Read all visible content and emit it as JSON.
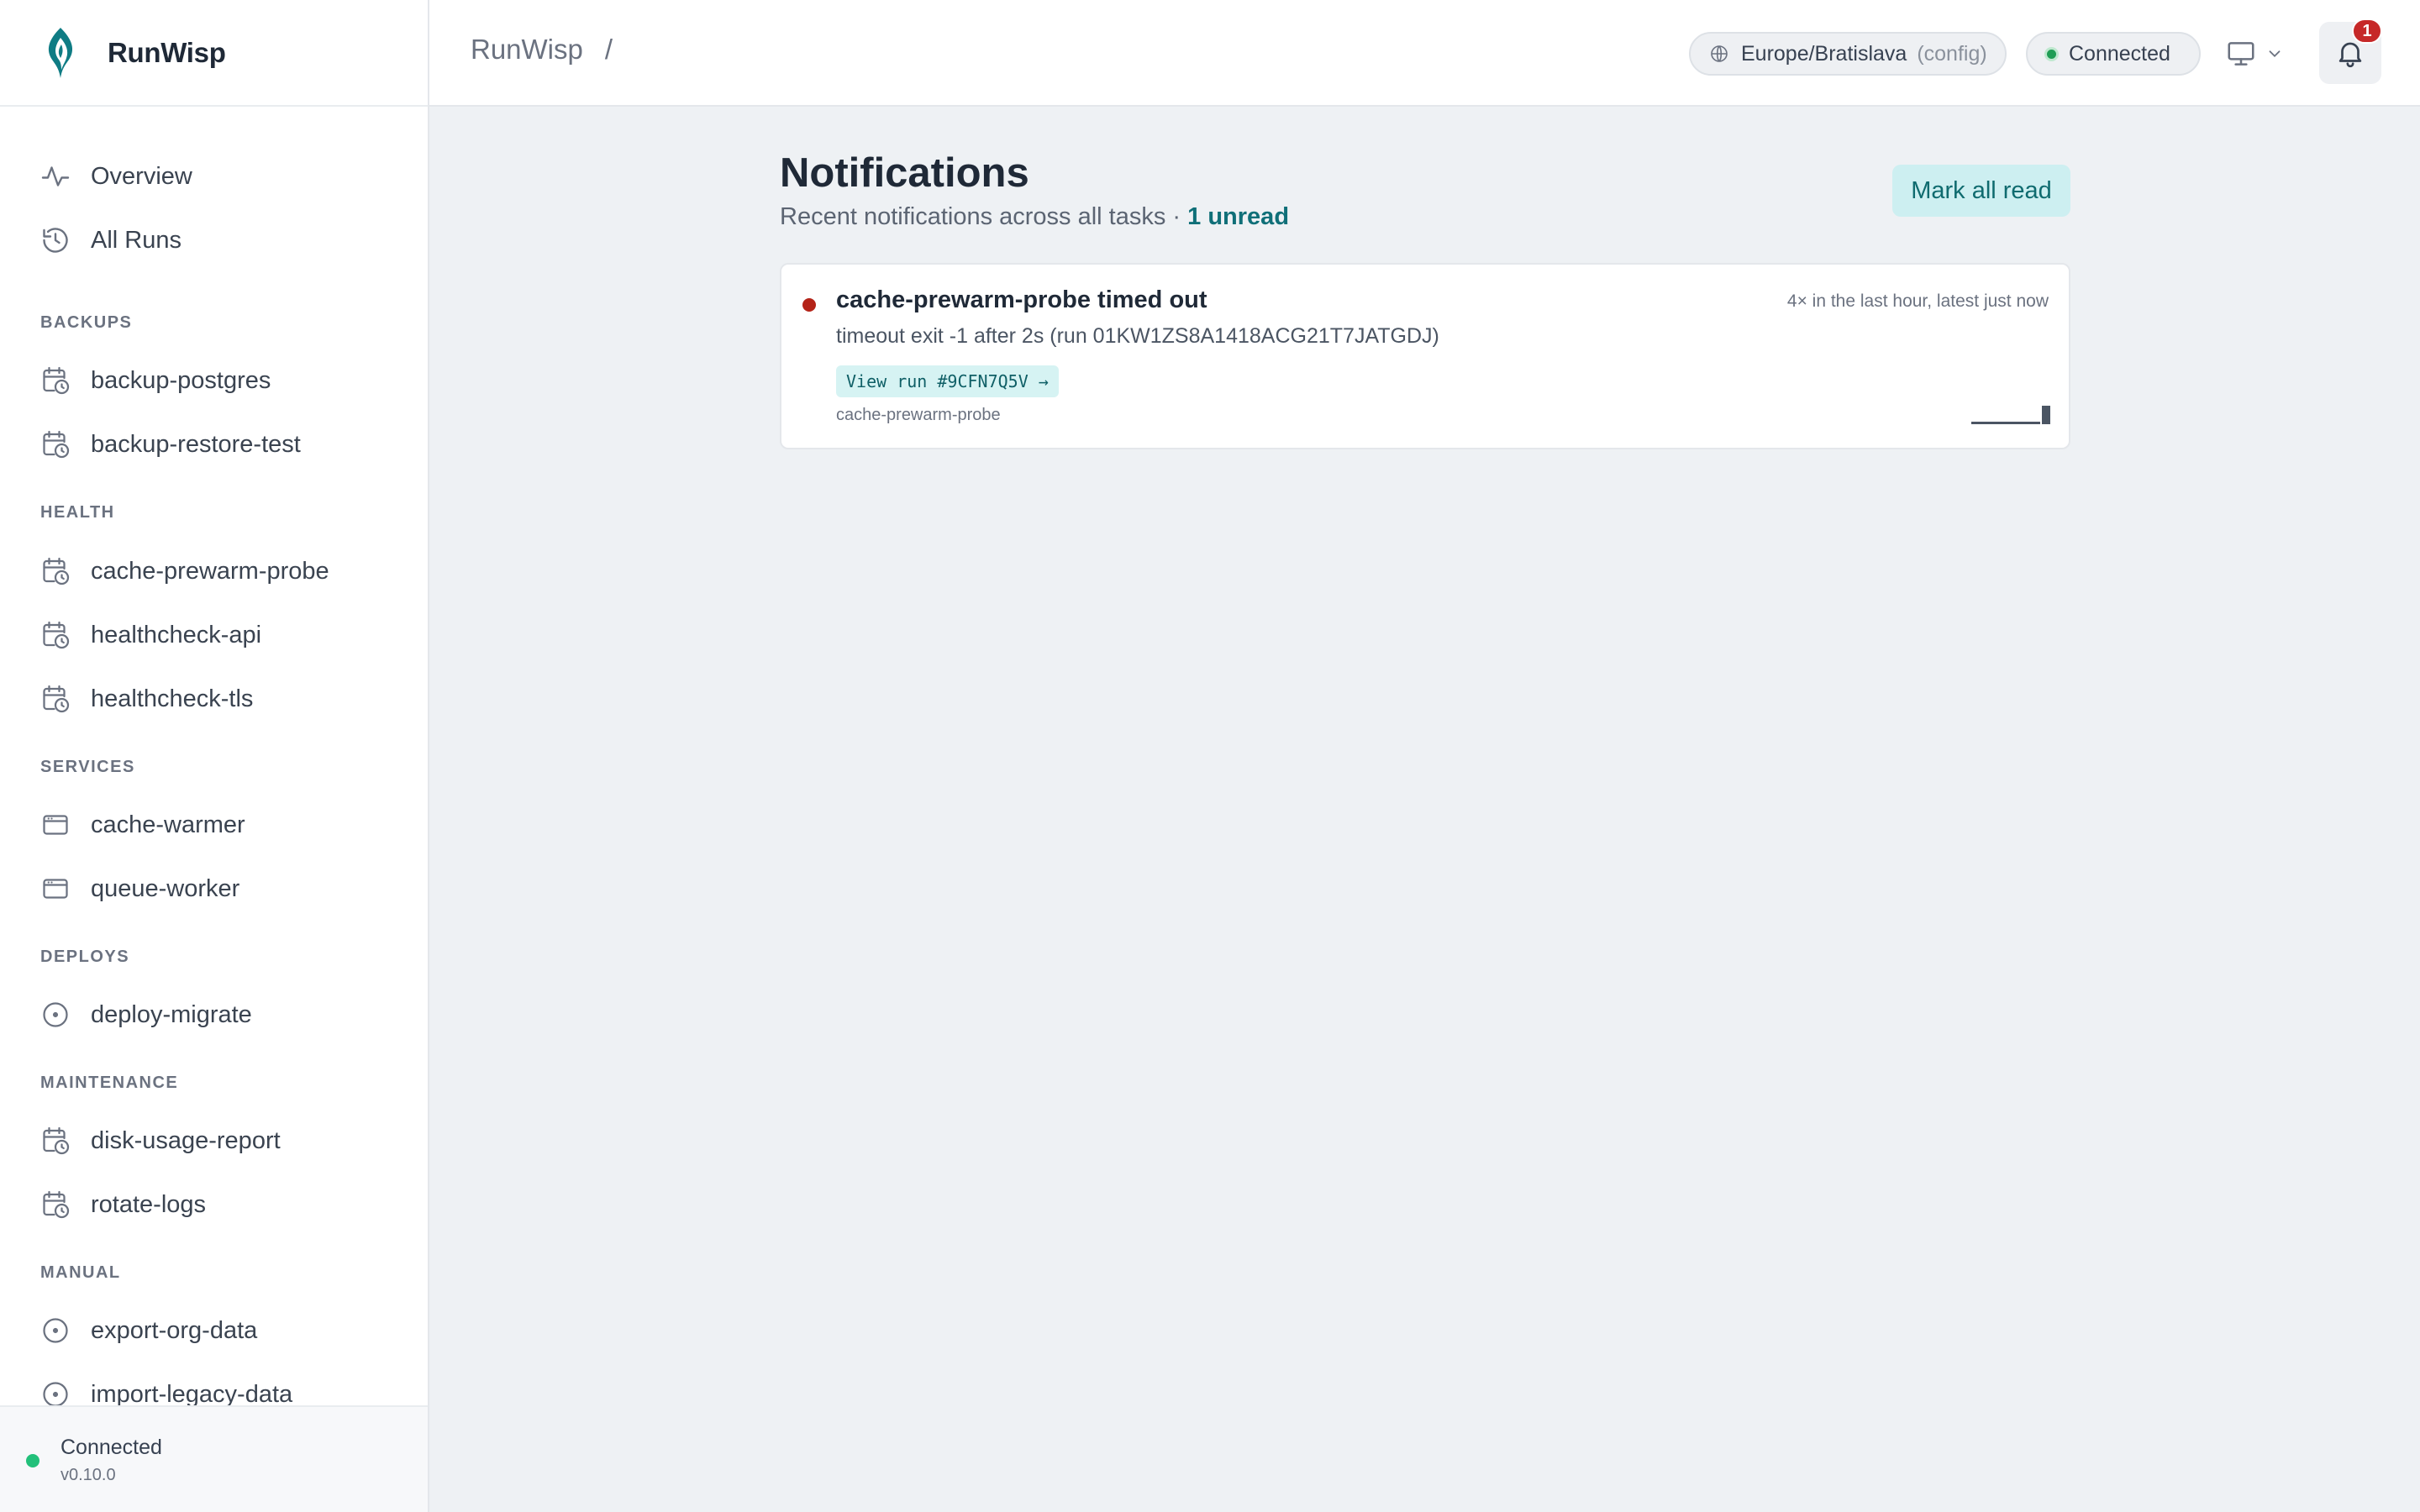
{
  "app": {
    "name": "RunWisp",
    "version": "v0.10.0",
    "status": "Connected"
  },
  "colors": {
    "accent": "#0f6f78",
    "connected": "#22c07a",
    "error": "#b42318",
    "badge": "#c62828"
  },
  "header": {
    "breadcrumb": "RunWisp",
    "breadcrumb_separator": "/",
    "timezone": "Europe/Bratislava",
    "timezone_source": "(config)",
    "connection": "Connected",
    "notification_count": "1",
    "icons": [
      "globe-icon",
      "monitor-icon",
      "chevron-down-icon",
      "bell-icon"
    ]
  },
  "sidebar": {
    "top": [
      {
        "label": "Overview",
        "icon": "activity-icon"
      },
      {
        "label": "All Runs",
        "icon": "history-icon"
      }
    ],
    "sections": [
      {
        "title": "BACKUPS",
        "items": [
          {
            "label": "backup-postgres",
            "icon": "calendar-clock-icon"
          },
          {
            "label": "backup-restore-test",
            "icon": "calendar-clock-icon"
          }
        ]
      },
      {
        "title": "HEALTH",
        "items": [
          {
            "label": "cache-prewarm-probe",
            "icon": "calendar-clock-icon"
          },
          {
            "label": "healthcheck-api",
            "icon": "calendar-clock-icon"
          },
          {
            "label": "healthcheck-tls",
            "icon": "calendar-clock-icon"
          }
        ]
      },
      {
        "title": "SERVICES",
        "items": [
          {
            "label": "cache-warmer",
            "icon": "window-icon"
          },
          {
            "label": "queue-worker",
            "icon": "window-icon"
          }
        ]
      },
      {
        "title": "DEPLOYS",
        "items": [
          {
            "label": "deploy-migrate",
            "icon": "circle-dot-icon"
          }
        ]
      },
      {
        "title": "MAINTENANCE",
        "items": [
          {
            "label": "disk-usage-report",
            "icon": "calendar-clock-icon"
          },
          {
            "label": "rotate-logs",
            "icon": "calendar-clock-icon"
          }
        ]
      },
      {
        "title": "MANUAL",
        "items": [
          {
            "label": "export-org-data",
            "icon": "circle-dot-icon"
          },
          {
            "label": "import-legacy-data",
            "icon": "circle-dot-icon"
          }
        ]
      }
    ]
  },
  "main": {
    "title": "Notifications",
    "subtitle": "Recent notifications across all tasks ·",
    "unread": "1 unread",
    "mark_all_read": "Mark all read",
    "notifications": [
      {
        "title": "cache-prewarm-probe timed out",
        "meta": "4× in the last hour, latest just now",
        "body": "timeout exit -1 after 2s (run 01KW1ZS8A1418ACG21T7JATGDJ)",
        "link": "View run #9CFN7Q5V →",
        "task": "cache-prewarm-probe",
        "unread": true
      }
    ]
  }
}
